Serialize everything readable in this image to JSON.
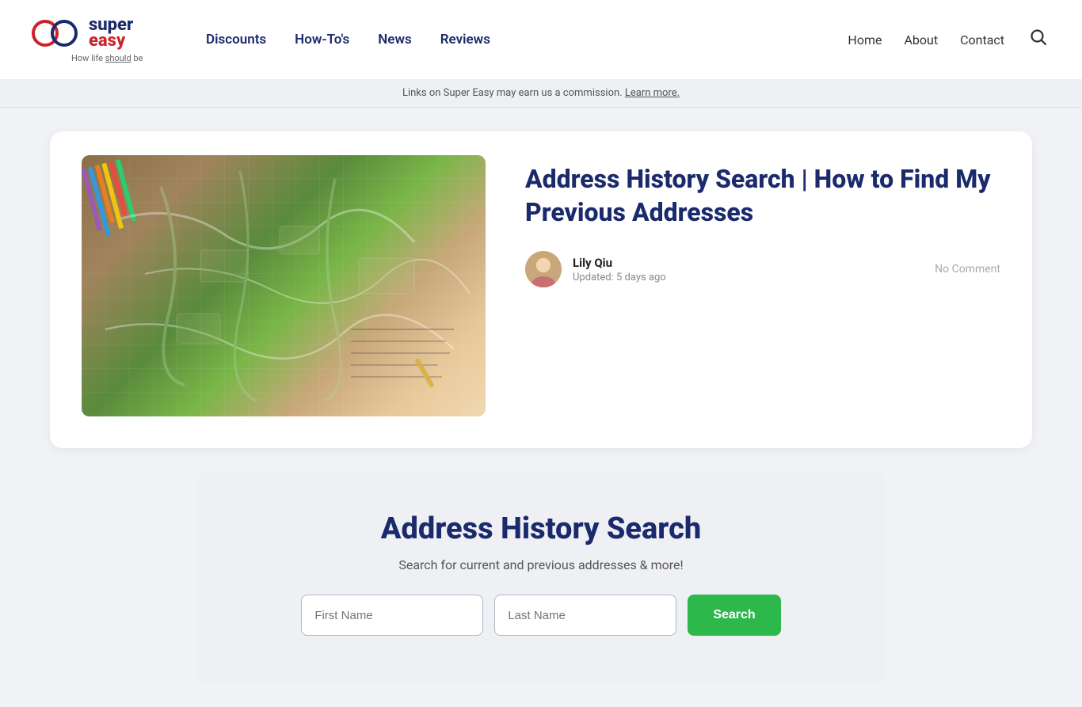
{
  "header": {
    "logo": {
      "super": "super",
      "easy": "easy",
      "tagline": "How life ",
      "tagline_em": "should",
      "tagline_rest": " be"
    },
    "nav": {
      "items": [
        {
          "label": "Discounts",
          "href": "#"
        },
        {
          "label": "How-To's",
          "href": "#"
        },
        {
          "label": "News",
          "href": "#"
        },
        {
          "label": "Reviews",
          "href": "#"
        }
      ]
    },
    "right_nav": {
      "items": [
        {
          "label": "Home",
          "href": "#"
        },
        {
          "label": "About",
          "href": "#"
        },
        {
          "label": "Contact",
          "href": "#"
        }
      ]
    }
  },
  "commission_banner": {
    "text": "Links on Super Easy may earn us a commission. ",
    "learn_more": "Learn more."
  },
  "article": {
    "title": "Address History Search | How to Find My Previous Addresses",
    "author": {
      "name": "Lily Qiu",
      "updated": "Updated: 5 days ago"
    },
    "no_comment": "No Comment"
  },
  "search_widget": {
    "title": "Address History Search",
    "subtitle": "Search for current and previous addresses & more!",
    "first_name_placeholder": "First Name",
    "last_name_placeholder": "Last Name",
    "button_label": "Search"
  }
}
